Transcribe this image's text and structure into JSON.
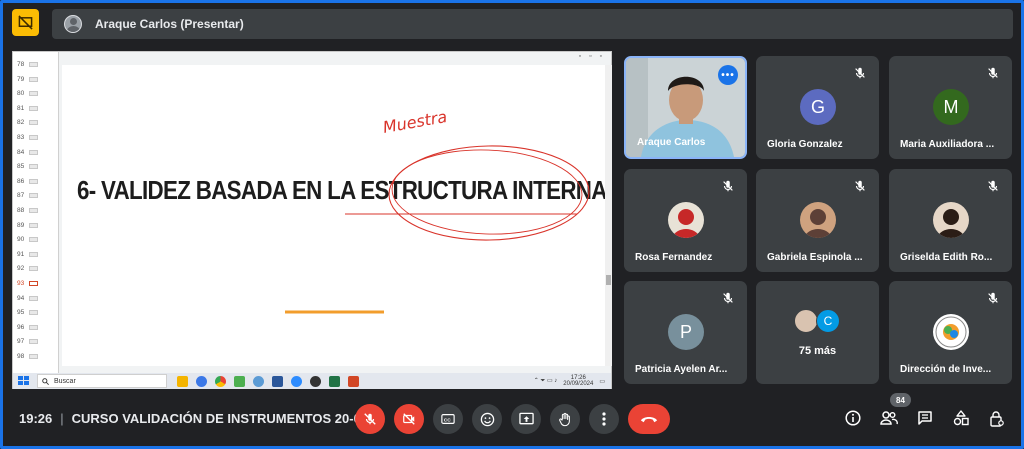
{
  "presenter": {
    "name": "Araque Carlos (Presentar)"
  },
  "slide": {
    "title_prefix": "6- VALIDEZ BASADA EN LA ",
    "title_circled": "ESTRUCTURA INTERNA",
    "annotation": "Muestra"
  },
  "ppt_thumbnails": [
    "78",
    "79",
    "80",
    "81",
    "82",
    "83",
    "84",
    "85",
    "86",
    "87",
    "88",
    "89",
    "90",
    "91",
    "92",
    "93",
    "94",
    "95",
    "96",
    "97",
    "98"
  ],
  "ppt_active_thumbnail": "93",
  "taskbar": {
    "search_placeholder": "Buscar",
    "time": "17:26",
    "date": "20/09/2024"
  },
  "participants": [
    {
      "name": "Araque Carlos",
      "type": "camera"
    },
    {
      "name": "Gloria Gonzalez",
      "initial": "G",
      "color": "#5c6bc0",
      "muted": true
    },
    {
      "name": "Maria Auxiliadora ...",
      "initial": "M",
      "color": "#33691e",
      "muted": true
    },
    {
      "name": "Rosa Fernandez",
      "type": "photo",
      "muted": true
    },
    {
      "name": "Gabriela Espinola ...",
      "type": "photo",
      "muted": true
    },
    {
      "name": "Griselda Edith Ro...",
      "type": "photo",
      "muted": true
    },
    {
      "name": "Patricia Ayelen Ar...",
      "initial": "P",
      "color": "#78909c",
      "muted": true
    },
    {
      "name": "75 más",
      "type": "overflow",
      "initial": "C"
    },
    {
      "name": "Dirección de Inve...",
      "type": "logo",
      "muted": true
    }
  ],
  "meeting": {
    "time": "19:26",
    "title": "CURSO VALIDACIÓN DE INSTRUMENTOS 20-0..."
  },
  "people_count": "84",
  "colors": {
    "accent": "#8ab4f8",
    "danger": "#ea4335",
    "surface": "#3c4043",
    "background": "#202124"
  }
}
